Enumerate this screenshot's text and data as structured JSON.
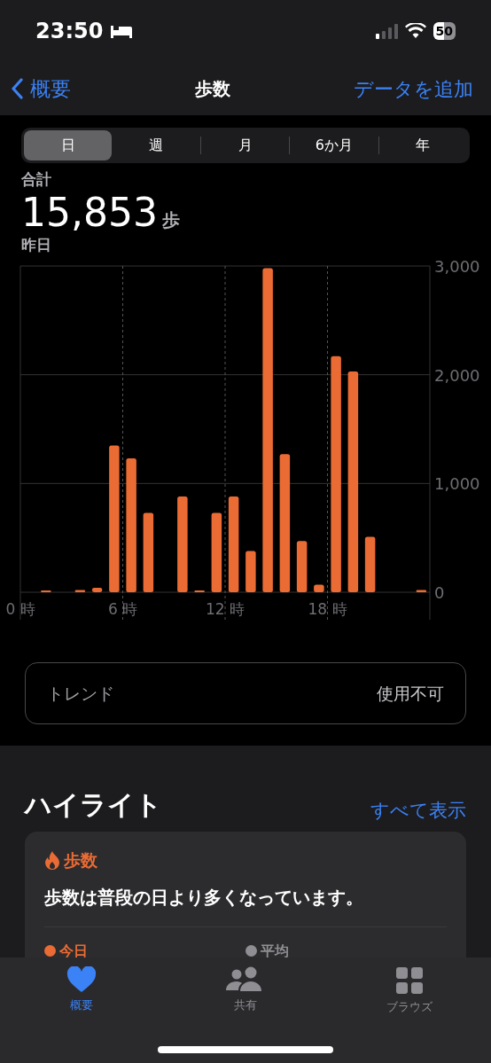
{
  "status_bar": {
    "time": "23:50",
    "battery": "50"
  },
  "nav": {
    "back": "概要",
    "title": "歩数",
    "action": "データを追加"
  },
  "segments": [
    {
      "label": "日",
      "selected": true
    },
    {
      "label": "週",
      "selected": false
    },
    {
      "label": "月",
      "selected": false
    },
    {
      "label": "6か月",
      "selected": false
    },
    {
      "label": "年",
      "selected": false
    }
  ],
  "summary": {
    "label": "合計",
    "value": "15,853",
    "unit": "歩",
    "date": "昨日"
  },
  "chart_data": {
    "type": "bar",
    "grid": true,
    "x": [
      1.5,
      3.5,
      4.5,
      5.5,
      6.5,
      7.5,
      9.5,
      10.5,
      11.5,
      12.5,
      13.5,
      14.5,
      15.5,
      16.5,
      17.5,
      18.5,
      19.5,
      20.5,
      23.5
    ],
    "values": [
      10,
      20,
      40,
      1350,
      1230,
      730,
      880,
      10,
      730,
      880,
      380,
      2980,
      1270,
      470,
      70,
      2170,
      2030,
      510,
      20
    ],
    "xlim": [
      0,
      24
    ],
    "ylim": [
      0,
      3000
    ],
    "xticks": [
      {
        "value": 0,
        "label": "0 時"
      },
      {
        "value": 6,
        "label": "6 時"
      },
      {
        "value": 12,
        "label": "12 時"
      },
      {
        "value": 18,
        "label": "18 時"
      }
    ],
    "yticks": [
      {
        "value": 0,
        "label": "0"
      },
      {
        "value": 1000,
        "label": "1,000"
      },
      {
        "value": 2000,
        "label": "2,000"
      },
      {
        "value": 3000,
        "label": "3,000"
      }
    ]
  },
  "trend": {
    "label": "トレンド",
    "value": "使用不可"
  },
  "highlights": {
    "title": "ハイライト",
    "link": "すべて表示",
    "card": {
      "category": "歩数",
      "message": "歩数は普段の日より多くなっています。",
      "legend": [
        {
          "label": "今日",
          "color": "#eb6b34"
        },
        {
          "label": "平均",
          "color": "#8e8e93"
        }
      ]
    }
  },
  "tab_bar": [
    {
      "label": "概要",
      "selected": true
    },
    {
      "label": "共有",
      "selected": false
    },
    {
      "label": "ブラウズ",
      "selected": false
    }
  ]
}
